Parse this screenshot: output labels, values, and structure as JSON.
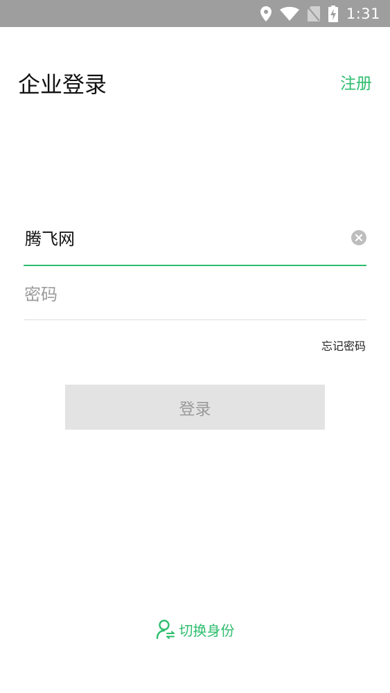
{
  "status_bar": {
    "time": "1:31",
    "icons": [
      "location-icon",
      "wifi-icon",
      "no-sim-icon",
      "battery-charging-icon"
    ]
  },
  "header": {
    "title": "企业登录",
    "register_label": "注册"
  },
  "form": {
    "account_value": "腾飞网",
    "password_placeholder": "密码",
    "forgot_label": "忘记密码",
    "login_label": "登录"
  },
  "footer": {
    "switch_identity_label": "切换身份"
  },
  "colors": {
    "accent": "#2dbd6e",
    "status_bar": "#9e9e9e",
    "button_disabled_bg": "#e3e3e3"
  }
}
